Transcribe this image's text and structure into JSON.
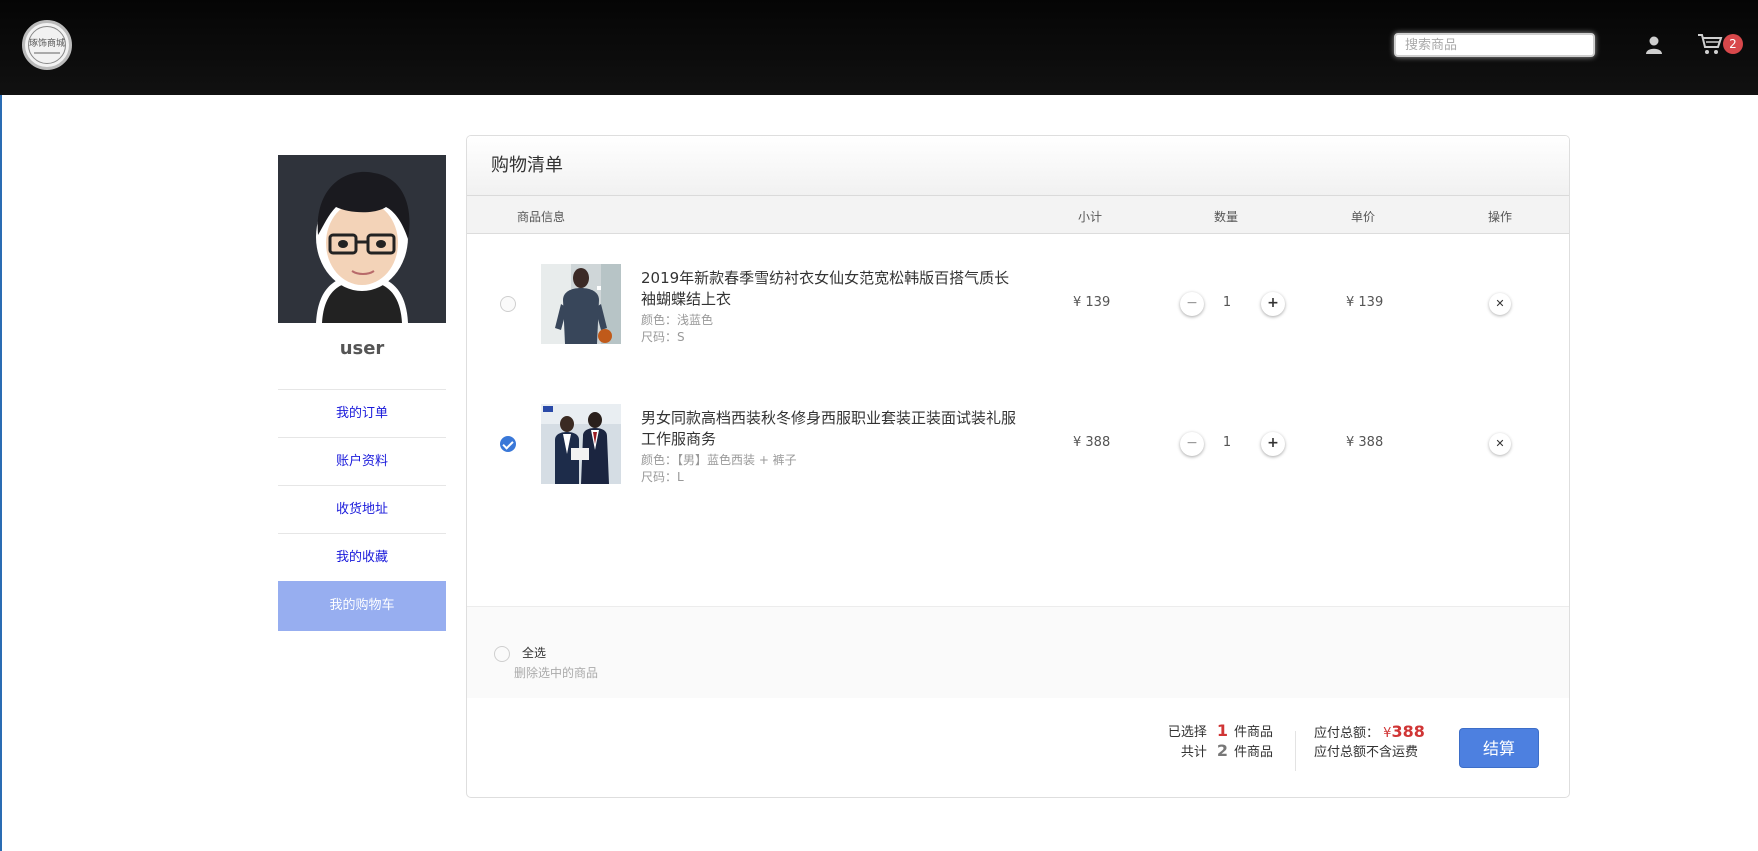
{
  "header": {
    "logo_text": "琢饰商城",
    "search_placeholder": "搜索商品",
    "cart_count": "2"
  },
  "sidebar": {
    "username": "user",
    "items": [
      {
        "label": "我的订单"
      },
      {
        "label": "账户资料"
      },
      {
        "label": "收货地址"
      },
      {
        "label": "我的收藏"
      },
      {
        "label": "我的购物车",
        "active": true
      }
    ]
  },
  "cart": {
    "title": "购物清单",
    "columns": {
      "info": "商品信息",
      "subtotal": "小计",
      "quantity": "数量",
      "unit_price": "单价",
      "action": "操作"
    },
    "items": [
      {
        "name": "2019年新款春季雪纺衬衣女仙女范宽松韩版百搭气质长袖蝴蝶结上衣",
        "color": "颜色：浅蓝色",
        "size": "尺码：S",
        "subtotal": "¥ 139",
        "quantity": "1",
        "unit_price": "¥ 139",
        "checked": false
      },
      {
        "name": "男女同款高档西装秋冬修身西服职业套装正装面试装礼服工作服商务",
        "color": "颜色：【男】蓝色西装 + 裤子",
        "size": "尺码：L",
        "subtotal": "¥ 388",
        "quantity": "1",
        "unit_price": "¥ 388",
        "checked": true
      }
    ],
    "select_all": "全选",
    "delete_selected": "删除选中的商品",
    "summary": {
      "selected_prefix": "已选择",
      "selected_count": "1",
      "selected_suffix": "件商品",
      "total_prefix": "共计",
      "total_count": "2",
      "total_suffix": "件商品",
      "amount_label": "应付总额：",
      "amount_currency": "¥",
      "amount_value": "388",
      "amount_note": "应付总额不含运费"
    },
    "checkout_label": "结算"
  },
  "colors": {
    "accent": "#4d80e0",
    "price_red": "#d03535",
    "sidebar_active": "#97aef0",
    "link": "#1a1adb"
  }
}
